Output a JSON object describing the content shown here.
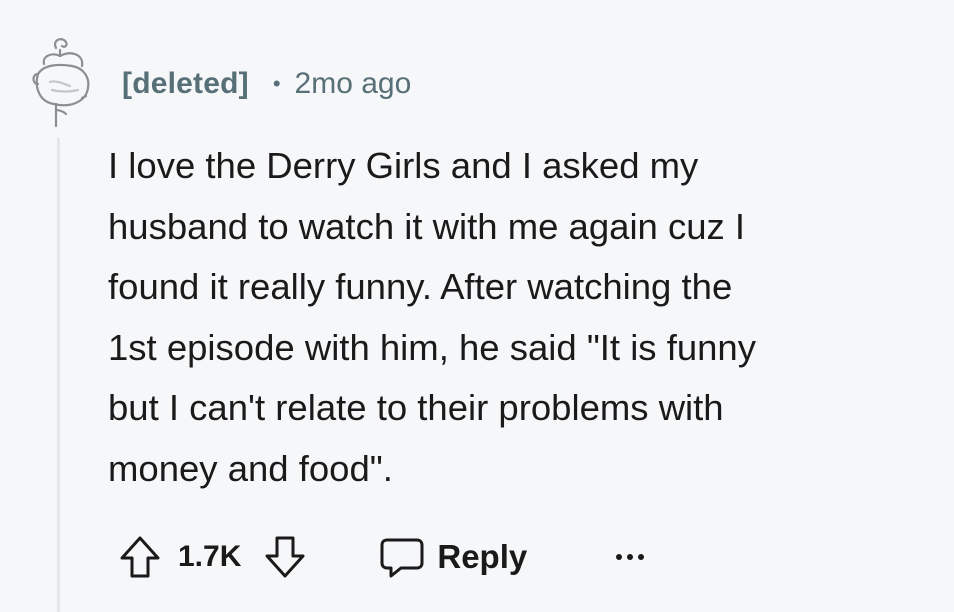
{
  "comment": {
    "author": "[deleted]",
    "separator": "•",
    "timestamp": "2mo ago",
    "body": "I love the Derry Girls and I asked my\nhusband to watch it with me again cuz I\nfound it really funny. After watching the\n1st episode with him, he said \"It is funny\nbut I can't relate to their problems with\nmoney and food\".",
    "avatar_icon": "snoo-avatar-icon"
  },
  "actions": {
    "upvote_icon": "upvote-arrow-icon",
    "score": "1.7K",
    "downvote_icon": "downvote-arrow-icon",
    "reply_icon": "speech-bubble-icon",
    "reply_label": "Reply",
    "more_icon": "ellipsis-icon"
  },
  "colors": {
    "background": "#f6f7f8",
    "text": "#1a1a1b",
    "meta_text": "#576f76",
    "thread_line": "#e4e6e8"
  }
}
